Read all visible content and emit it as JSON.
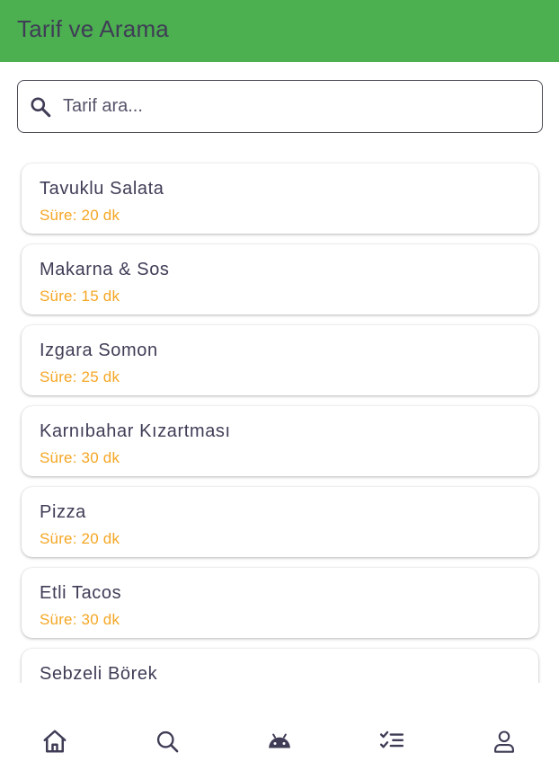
{
  "appbar": {
    "title": "Tarif ve Arama",
    "background": "#4caf50"
  },
  "search": {
    "placeholder": "Tarif ara...",
    "value": "",
    "icon": "search-icon"
  },
  "recipes": [
    {
      "name": "Tavuklu Salata",
      "duration": "Süre: 20 dk"
    },
    {
      "name": "Makarna & Sos",
      "duration": "Süre: 15 dk"
    },
    {
      "name": "Izgara Somon",
      "duration": "Süre: 25 dk"
    },
    {
      "name": "Karnıbahar Kızartması",
      "duration": "Süre: 30 dk"
    },
    {
      "name": "Pizza",
      "duration": "Süre: 20 dk"
    },
    {
      "name": "Etli Tacos",
      "duration": "Süre: 30 dk"
    },
    {
      "name": "Sebzeli Börek",
      "duration": ""
    }
  ],
  "colors": {
    "accent": "#4caf50",
    "duration_text": "#f5a623",
    "primary_text": "#3f3d56"
  },
  "bottom_nav": {
    "items": [
      {
        "icon": "home-icon"
      },
      {
        "icon": "search-icon"
      },
      {
        "icon": "android-icon"
      },
      {
        "icon": "checklist-icon"
      },
      {
        "icon": "profile-icon"
      }
    ]
  }
}
